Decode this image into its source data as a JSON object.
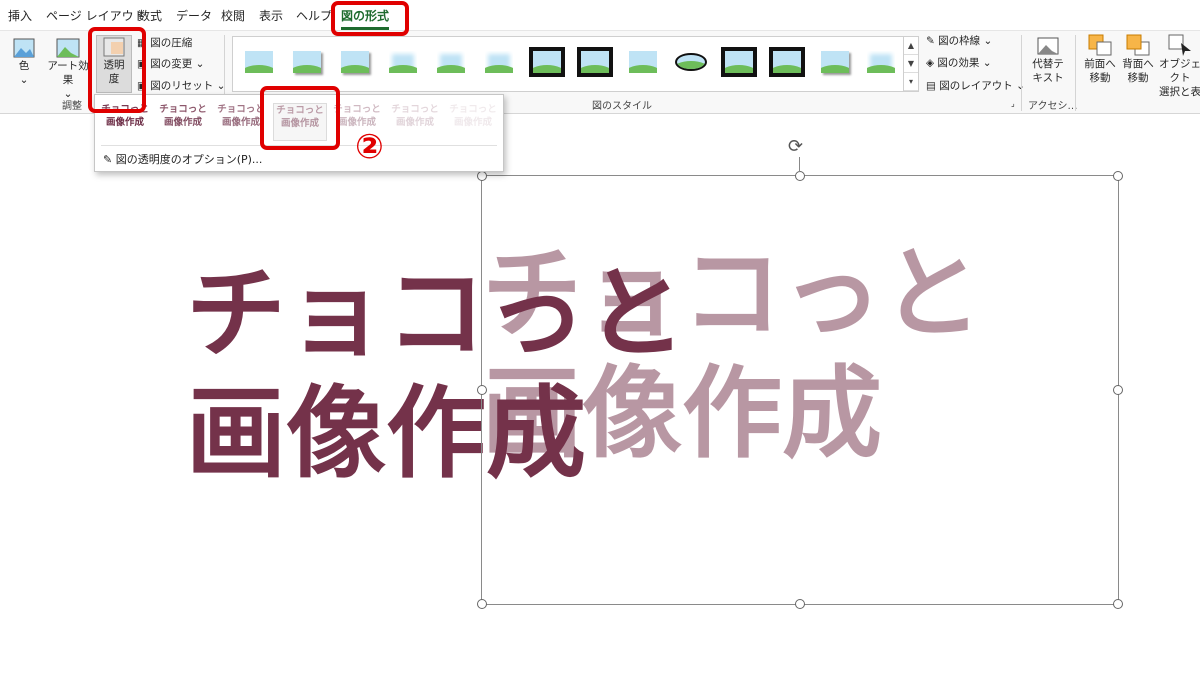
{
  "tabs": {
    "insert": "挿入",
    "page_layout": "ページ レイアウト",
    "formulas": "数式",
    "data": "データ",
    "review": "校閲",
    "view": "表示",
    "help": "ヘルプ",
    "picture_format": "図の形式"
  },
  "ribbon": {
    "color_label": "色",
    "artistic_effects_label": "アート効果",
    "transparency_line1": "透明",
    "transparency_line2": "度",
    "compress_label": "図の圧縮",
    "change_label": "図の変更",
    "reset_label": "図のリセット",
    "adjust_group": "調整",
    "styles_group": "図のスタイル",
    "border_label": "図の枠線",
    "effects_label": "図の効果",
    "layout_label": "図のレイアウト",
    "alt_text_line1": "代替テ",
    "alt_text_line2": "キスト",
    "accessibility_group": "アクセシ…",
    "bring_forward_line1": "前面へ",
    "bring_forward_line2": "移動",
    "send_backward_line1": "背面へ",
    "send_backward_line2": "移動",
    "selection_pane_line1": "オブジェクト",
    "selection_pane_line2": "選択と表"
  },
  "transparency_menu": {
    "presets": [
      {
        "line1": "チョコっと",
        "line2": "画像作成",
        "opacity": 1.0
      },
      {
        "line1": "チョコっと",
        "line2": "画像作成",
        "opacity": 0.85
      },
      {
        "line1": "チョコっと",
        "line2": "画像作成",
        "opacity": 0.7
      },
      {
        "line1": "チョコっと",
        "line2": "画像作成",
        "opacity": 0.5
      },
      {
        "line1": "チョコっと",
        "line2": "画像作成",
        "opacity": 0.35
      },
      {
        "line1": "チョコっと",
        "line2": "画像作成",
        "opacity": 0.2
      },
      {
        "line1": "チョコっと",
        "line2": "画像作成",
        "opacity": 0.1
      }
    ],
    "options_link": "図の透明度のオプション(P)..."
  },
  "annotation": {
    "step_number": "②",
    "highlight_color": "#e00000"
  },
  "canvas": {
    "original_line1": "チョコっと",
    "original_line2": "画像作成",
    "faded_line1": "チョコっと",
    "faded_line2": "画像作成",
    "text_color": "#74324a",
    "faded_opacity": 0.5
  },
  "colors": {
    "accent": "#1e6b2e"
  }
}
